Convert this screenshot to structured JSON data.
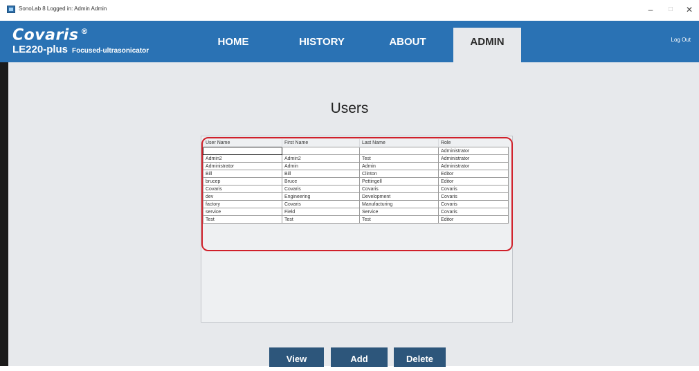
{
  "window": {
    "title": "SonoLab 8 Logged in: Admin Admin",
    "controls": {
      "minimize": "–",
      "maximize": "□",
      "close": "✕"
    }
  },
  "brand": {
    "name": "Covaris",
    "mark": "®",
    "model": "LE220-plus",
    "description": "Focused-ultrasonicator"
  },
  "nav": {
    "home": "HOME",
    "history": "HISTORY",
    "about": "ABOUT",
    "admin": "ADMIN",
    "active": "ADMIN",
    "logout": "Log Out"
  },
  "page": {
    "title": "Users"
  },
  "users_table": {
    "columns": [
      "User Name",
      "First Name",
      "Last Name",
      "Role"
    ],
    "rows": [
      [
        "",
        "",
        "",
        "Administrator"
      ],
      [
        "Admin2",
        "Admin2",
        "Test",
        "Administrator"
      ],
      [
        "Administrator",
        "Admin",
        "Admin",
        "Administrator"
      ],
      [
        "Bill",
        "Bill",
        "Clinton",
        "Editor"
      ],
      [
        "brucep",
        "Bruce",
        "Pettingell",
        "Editor"
      ],
      [
        "Covaris",
        "Covaris",
        "Covaris",
        "Covaris"
      ],
      [
        "dev",
        "Engineering",
        "Development",
        "Covaris"
      ],
      [
        "factory",
        "Covaris",
        "Manufacturing",
        "Covaris"
      ],
      [
        "service",
        "Field",
        "Service",
        "Covaris"
      ],
      [
        "Test",
        "Test",
        "Test",
        "Editor"
      ]
    ]
  },
  "buttons": {
    "view": "View",
    "add": "Add",
    "delete": "Delete"
  },
  "colors": {
    "header": "#2a72b4",
    "content_bg": "#e7e9ec",
    "button": "#2d567b",
    "highlight": "#d0202a"
  }
}
